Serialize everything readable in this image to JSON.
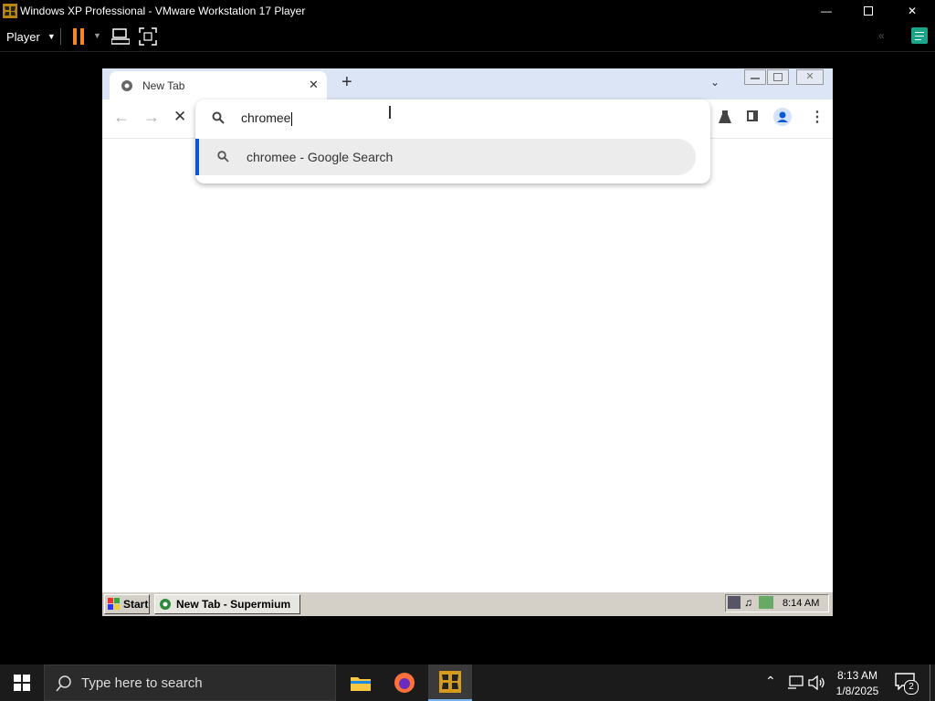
{
  "vmware": {
    "title": "Windows XP Professional - VMware Workstation 17 Player",
    "player_menu": "Player",
    "window_controls": [
      "minimize",
      "maximize",
      "close"
    ]
  },
  "browser": {
    "tab_title": "New Tab",
    "omnibox_text": "chromee",
    "suggestion_text": "chromee - Google Search"
  },
  "xp_taskbar": {
    "start_label": "Start",
    "task_label": "New Tab - Supermium",
    "clock": "8:14 AM"
  },
  "win_taskbar": {
    "search_placeholder": "Type here to search",
    "time": "8:13 AM",
    "date": "1/8/2025",
    "notification_count": "2"
  },
  "colors": {
    "tabstrip": "#dce5f5",
    "suggestion_accent": "#0b57d0",
    "pause_orange": "#f08a24",
    "xp_gray": "#d4d0c8"
  }
}
